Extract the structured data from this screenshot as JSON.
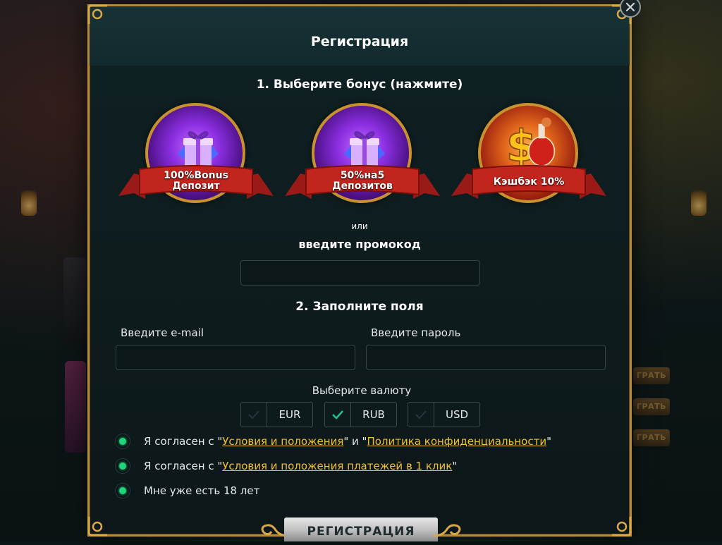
{
  "modal": {
    "title": "Регистрация",
    "step1_title": "1. Выберите бонус (нажмите)",
    "bonuses": [
      {
        "line1": "100%Bonus",
        "line2": "Депозит"
      },
      {
        "line1": "50%на5",
        "line2": "Депозитов"
      },
      {
        "line1": "Кэшбэк 10%",
        "line2": ""
      }
    ],
    "or_text": "или",
    "promo_label": "введите промокод",
    "promo_value": "",
    "step2_title": "2. Заполните поля",
    "email_label": "Введите e-mail",
    "email_value": "",
    "password_label": "Введите пароль",
    "password_value": "",
    "currency_label": "Выберите валюту",
    "currencies": [
      {
        "code": "EUR",
        "selected": false
      },
      {
        "code": "RUB",
        "selected": true
      },
      {
        "code": "USD",
        "selected": false
      }
    ],
    "agreements": [
      {
        "prefix": "Я согласен с \"",
        "link1": "Условия и положения",
        "mid": "\" и \"",
        "link2": "Политика конфиденциальности",
        "suffix": "\"",
        "checked": true
      },
      {
        "prefix": "Я согласен с \"",
        "link1": "Условия и положения платежей в 1 клик",
        "suffix": "\"",
        "checked": true
      },
      {
        "text": "Мне уже есть 18 лет",
        "checked": true
      }
    ],
    "submit_label": "РЕГИСТРАЦИЯ"
  },
  "background": {
    "buttons": [
      "ГРАТЬ",
      "ГРАТЬ",
      "ГРАТЬ"
    ]
  },
  "colors": {
    "accent_gold": "#b58a3c",
    "link_yellow": "#f0c02c",
    "check_green": "#1fd47a",
    "panel_bg": "#0e1b1d"
  }
}
